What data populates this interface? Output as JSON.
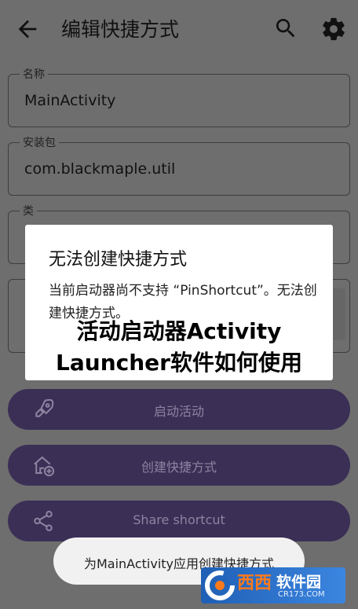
{
  "header": {
    "title": "编辑快捷方式",
    "icons": [
      "back-arrow-icon",
      "search-icon",
      "gear-icon"
    ]
  },
  "form": {
    "name": {
      "label": "名称",
      "value": "MainActivity"
    },
    "package": {
      "label": "安装包",
      "value": "com.blackmaple.util"
    },
    "class": {
      "label": "类",
      "value": ""
    },
    "icon_field": {
      "label": ""
    }
  },
  "buttons": {
    "launch": {
      "label": "启动活动",
      "icon": "rocket-icon"
    },
    "create": {
      "label": "创建快捷方式",
      "icon": "add-to-home-icon"
    },
    "share": {
      "label": "Share shortcut",
      "icon": "share-icon"
    }
  },
  "dialog": {
    "title": "无法创建快捷方式",
    "message": "当前启动器尚不支持 “PinShortcut”。无法创建快捷方式。"
  },
  "overlay": {
    "line1": "活动启动器Activity",
    "line2": "Launcher软件如何使用"
  },
  "toast": {
    "text": "为MainActivity应用创建快捷方式"
  },
  "watermark": {
    "brand": "西西",
    "name": "软件园",
    "domain": "CR173.COM"
  },
  "colors": {
    "background": "#6e6e6e",
    "button": "#3b2f56",
    "button_text": "#8c84a0",
    "dialog": "#ffffff"
  }
}
